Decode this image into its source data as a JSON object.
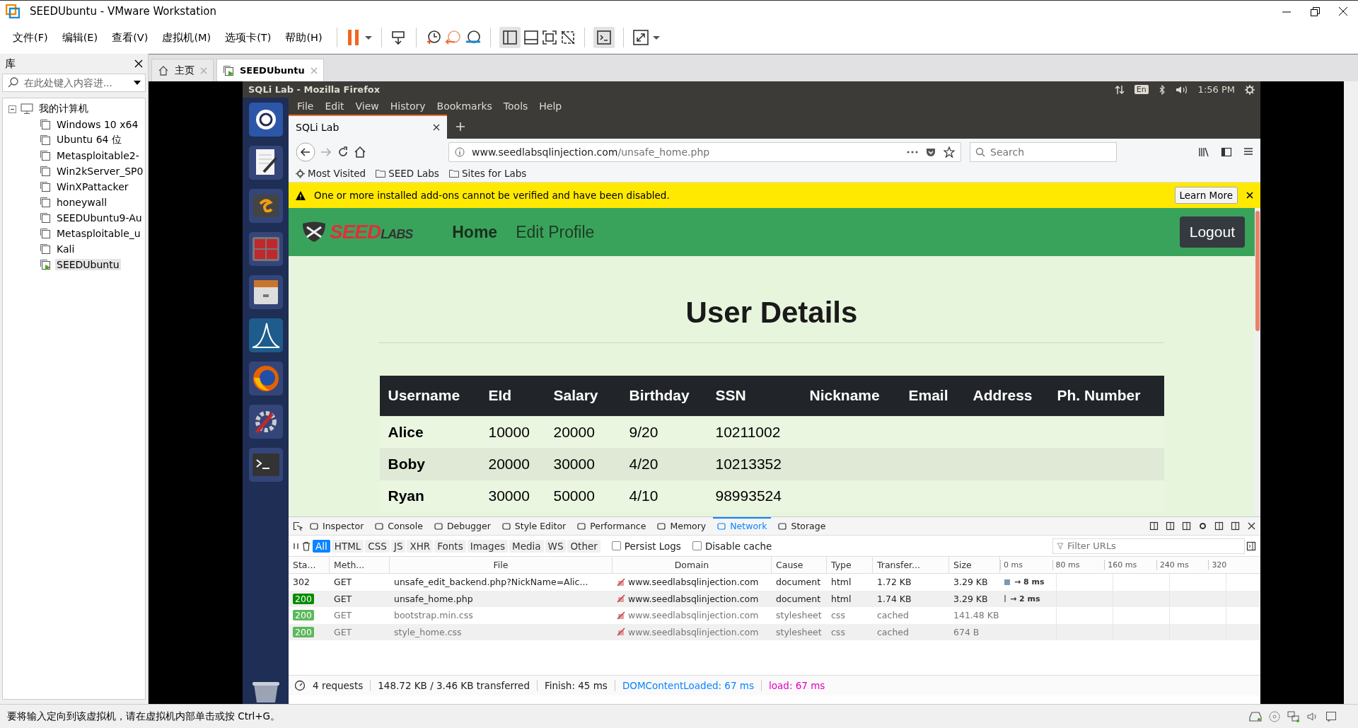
{
  "window": {
    "title": "SEEDUbuntu - VMware Workstation"
  },
  "menu": [
    "文件(F)",
    "编辑(E)",
    "查看(V)",
    "虚拟机(M)",
    "选项卡(T)",
    "帮助(H)"
  ],
  "library": {
    "title": "库",
    "search": {
      "placeholder": "在此处键入内容进..."
    },
    "tree": [
      {
        "label": "我的计算机",
        "expanded": true,
        "children": [
          {
            "label": "Windows 10 x64",
            "running": false,
            "selected": false
          },
          {
            "label": "Ubuntu 64 位",
            "running": false,
            "selected": false
          },
          {
            "label": "Metasploitable2-",
            "running": false,
            "selected": false
          },
          {
            "label": "Win2kServer_SP0",
            "running": false,
            "selected": false
          },
          {
            "label": "WinXPattacker",
            "running": false,
            "selected": false
          },
          {
            "label": "honeywall",
            "running": false,
            "selected": false
          },
          {
            "label": "SEEDUbuntu9-Au",
            "running": false,
            "selected": false
          },
          {
            "label": "Metasploitable_u",
            "running": false,
            "selected": false
          },
          {
            "label": "Kali",
            "running": false,
            "selected": false
          },
          {
            "label": "SEEDUbuntu",
            "running": true,
            "selected": true
          }
        ]
      }
    ]
  },
  "tabs": [
    {
      "label": "主页",
      "kind": "home",
      "selected": false
    },
    {
      "label": "SEEDUbuntu",
      "kind": "vm",
      "selected": true
    }
  ],
  "guest": {
    "top_bar": {
      "title": "SQLi Lab - Mozilla Firefox",
      "keyboard": "En",
      "time": "1:56 PM"
    },
    "firefox": {
      "menu": [
        "File",
        "Edit",
        "View",
        "History",
        "Bookmarks",
        "Tools",
        "Help"
      ],
      "tabs": [
        {
          "label": "SQLi Lab",
          "selected": true
        }
      ],
      "url": {
        "host": "www.seedlabsqlinjection.com",
        "path": "/unsafe_home.php"
      },
      "search": {
        "placeholder": "Search"
      },
      "bookmarks": [
        {
          "label": "Most Visited",
          "kind": "gear"
        },
        {
          "label": "SEED Labs",
          "kind": "folder"
        },
        {
          "label": "Sites for Labs",
          "kind": "folder"
        }
      ],
      "notification": {
        "text": "One or more installed add-ons cannot be verified and have been disabled.",
        "button": "Learn More"
      }
    },
    "page": {
      "logo": {
        "first": "SEED",
        "second": "LABS"
      },
      "nav": [
        {
          "label": "Home",
          "selected": true
        },
        {
          "label": "Edit Profile",
          "selected": false
        }
      ],
      "logout": "Logout",
      "heading": "User Details",
      "table": {
        "columns": [
          "Username",
          "EId",
          "Salary",
          "Birthday",
          "SSN",
          "Nickname",
          "Email",
          "Address",
          "Ph. Number"
        ],
        "rows": [
          [
            "Alice",
            "10000",
            "20000",
            "9/20",
            "10211002"
          ],
          [
            "Boby",
            "20000",
            "30000",
            "4/20",
            "10213352"
          ],
          [
            "Ryan",
            "30000",
            "50000",
            "4/10",
            "98993524"
          ]
        ]
      }
    },
    "devtools": {
      "tabs": [
        {
          "label": "Inspector",
          "selected": false
        },
        {
          "label": "Console",
          "selected": false
        },
        {
          "label": "Debugger",
          "selected": false
        },
        {
          "label": "Style Editor",
          "selected": false
        },
        {
          "label": "Performance",
          "selected": false
        },
        {
          "label": "Memory",
          "selected": false
        },
        {
          "label": "Network",
          "selected": true
        },
        {
          "label": "Storage",
          "selected": false
        }
      ],
      "filters": [
        {
          "label": "All",
          "selected": true
        },
        {
          "label": "HTML",
          "selected": false
        },
        {
          "label": "CSS",
          "selected": false
        },
        {
          "label": "JS",
          "selected": false
        },
        {
          "label": "XHR",
          "selected": false
        },
        {
          "label": "Fonts",
          "selected": false
        },
        {
          "label": "Images",
          "selected": false
        },
        {
          "label": "Media",
          "selected": false
        },
        {
          "label": "WS",
          "selected": false
        },
        {
          "label": "Other",
          "selected": false
        }
      ],
      "options": [
        {
          "label": "Persist Logs",
          "checked": false
        },
        {
          "label": "Disable cache",
          "checked": false
        }
      ],
      "filter_field": {
        "placeholder": "Filter URLs"
      },
      "columns": [
        "Sta...",
        "Meth...",
        "File",
        "Domain",
        "Cause",
        "Type",
        "Transfer...",
        "Size"
      ],
      "ticks": [
        "0 ms",
        "80 ms",
        "160 ms",
        "240 ms",
        "320"
      ],
      "requests": [
        {
          "status": "302",
          "badge": false,
          "method": "GET",
          "file": "unsafe_edit_backend.php?NickName=Alic...",
          "domain": "www.seedlabsqlinjection.com",
          "cause": "document",
          "type": "html",
          "transferred": "1.72 KB",
          "size": "3.29 KB",
          "cached": false,
          "timing": "→ 8 ms"
        },
        {
          "status": "200",
          "badge": true,
          "method": "GET",
          "file": "unsafe_home.php",
          "domain": "www.seedlabsqlinjection.com",
          "cause": "document",
          "type": "html",
          "transferred": "1.74 KB",
          "size": "3.29 KB",
          "cached": false,
          "timing": "→ 2 ms"
        },
        {
          "status": "200",
          "badge": true,
          "method": "GET",
          "file": "bootstrap.min.css",
          "domain": "www.seedlabsqlinjection.com",
          "cause": "stylesheet",
          "type": "css",
          "transferred": "cached",
          "size": "141.48 KB",
          "cached": true
        },
        {
          "status": "200",
          "badge": true,
          "method": "GET",
          "file": "style_home.css",
          "domain": "www.seedlabsqlinjection.com",
          "cause": "stylesheet",
          "type": "css",
          "transferred": "cached",
          "size": "674 B",
          "cached": true
        }
      ],
      "summary": [
        {
          "text": "4 requests",
          "kind": "plain"
        },
        {
          "text": "148.72 KB / 3.46 KB transferred",
          "kind": "plain"
        },
        {
          "text": "Finish: 45 ms",
          "kind": "plain"
        },
        {
          "text": "DOMContentLoaded: 67 ms",
          "kind": "dom"
        },
        {
          "text": "load: 67 ms",
          "kind": "load"
        }
      ]
    }
  },
  "status_bar": {
    "text": "要将输入定向到该虚拟机，请在虚拟机内部单击或按 Ctrl+G。"
  }
}
